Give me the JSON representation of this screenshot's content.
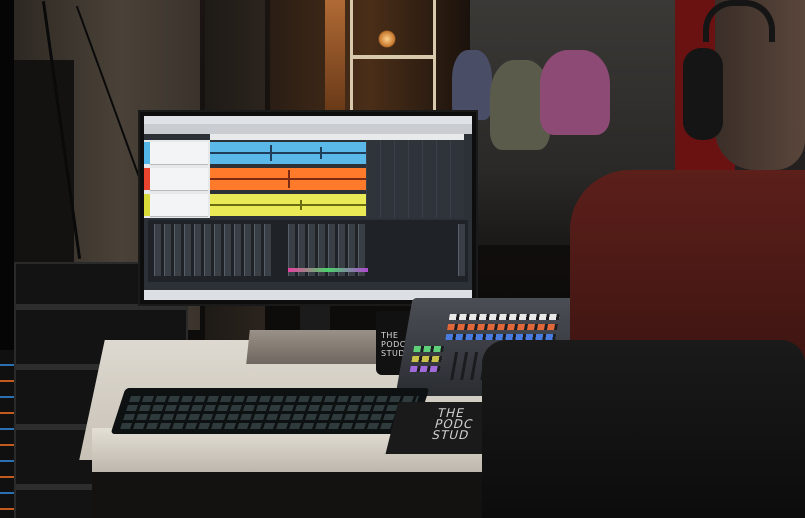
{
  "scene": {
    "subject": "podcast studio control room",
    "mug_text": [
      "THE",
      "PODCAST",
      "STUDIOS"
    ],
    "mousepad_text": [
      "THE",
      "PODC",
      "STUD"
    ]
  },
  "daw": {
    "tracks": [
      {
        "color": "#52b7e8"
      },
      {
        "color": "#e8432f"
      },
      {
        "color": "#d8da3a"
      }
    ]
  },
  "colors": {
    "wave_blue": "#5bb9ea",
    "wave_red": "#ff7a2a",
    "wave_yellow": "#e9ea55",
    "shirt_red": "#5c1f1a",
    "controller_top": "#4b4e55"
  }
}
